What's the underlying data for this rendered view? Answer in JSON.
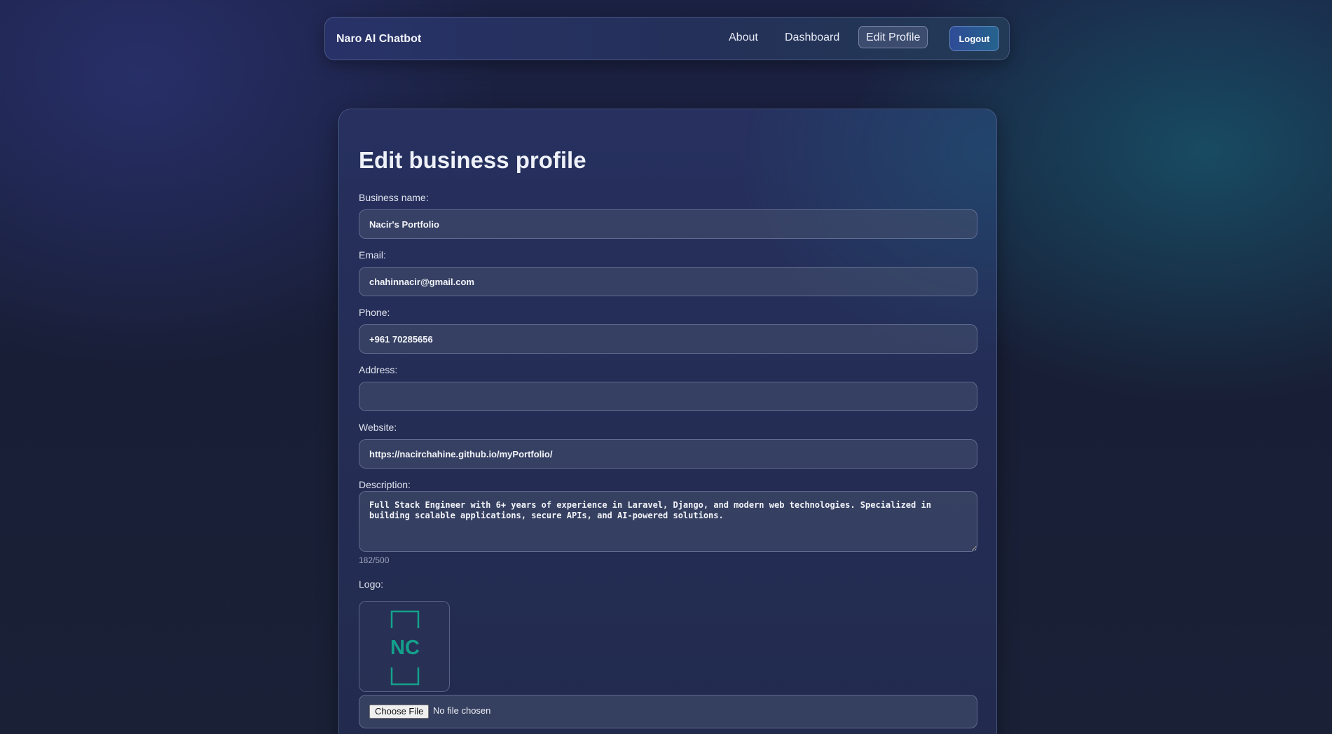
{
  "navbar": {
    "brand": "Naro AI Chatbot",
    "links": {
      "about": "About",
      "dashboard": "Dashboard",
      "edit_profile": "Edit Profile"
    },
    "logout_label": "Logout"
  },
  "page": {
    "title": "Edit business profile"
  },
  "form": {
    "business_name": {
      "label": "Business name:",
      "value": "Nacir's Portfolio"
    },
    "email": {
      "label": "Email:",
      "value": "chahinnacir@gmail.com"
    },
    "phone": {
      "label": "Phone:",
      "value": "+961 70285656"
    },
    "address": {
      "label": "Address:",
      "value": ""
    },
    "website": {
      "label": "Website:",
      "value": "https://nacirchahine.github.io/myPortfolio/"
    },
    "description": {
      "label": "Description:",
      "value": "Full Stack Engineer with 6+ years of experience in Laravel, Django, and modern web technologies. Specialized in building scalable applications, secure APIs, and AI-powered solutions.",
      "char_count": "182/500"
    },
    "logo": {
      "label": "Logo:",
      "preview_text": "NC",
      "preview_color": "#14a08c",
      "choose_file_label": "Choose File",
      "file_status": "No file chosen"
    }
  },
  "theme": {
    "accent": "#2f4c96",
    "logo_green": "#14a08c"
  }
}
